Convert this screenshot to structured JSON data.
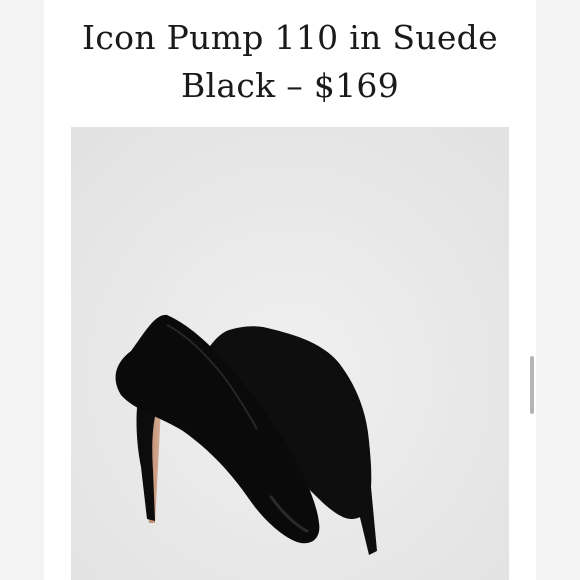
{
  "product": {
    "title_line1": "Icon Pump 110 in Suede",
    "title_line2": "Black – $169"
  },
  "image": {
    "icon": "black-suede-pumps-photo"
  },
  "colors": {
    "background": "#ffffff",
    "photo_backdrop": "#e9e9e9",
    "shoe": "#0d0d0d",
    "heel_lining": "#c79b80"
  }
}
